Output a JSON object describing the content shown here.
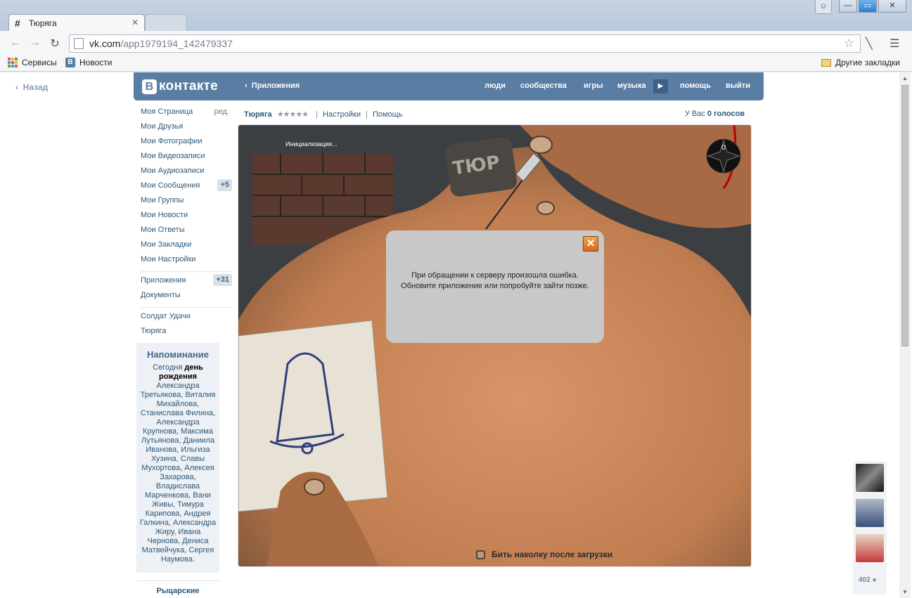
{
  "browser": {
    "tabs": [
      {
        "title": "Тюряга",
        "active": true
      },
      {
        "title": "",
        "active": false
      }
    ],
    "url_host": "vk.com",
    "url_path": "/app1979194_142479337",
    "bookmarks": [
      {
        "label": "Сервисы",
        "icon": "apps-grid-icon"
      },
      {
        "label": "Новости",
        "icon": "vk-icon"
      }
    ],
    "other_bookmarks": "Другие закладки"
  },
  "back_label": "Назад",
  "header": {
    "logo_letter": "В",
    "logo_text": "контакте",
    "apps_label": "Приложения",
    "nav": [
      "люди",
      "сообщества",
      "игры",
      "музыка",
      "помощь",
      "выйти"
    ],
    "accent": "#597da3"
  },
  "left_menu": {
    "items": [
      {
        "label": "Моя Страница",
        "extra": "ред."
      },
      {
        "label": "Мои Друзья"
      },
      {
        "label": "Мои Фотографии"
      },
      {
        "label": "Мои Видеозаписи"
      },
      {
        "label": "Мои Аудиозаписи"
      },
      {
        "label": "Мои Сообщения",
        "count": "+5"
      },
      {
        "label": "Мои Группы"
      },
      {
        "label": "Мои Новости"
      },
      {
        "label": "Мои Ответы"
      },
      {
        "label": "Мои Закладки"
      },
      {
        "label": "Мои Настройки"
      }
    ],
    "items2": [
      {
        "label": "Приложения",
        "count": "+31"
      },
      {
        "label": "Документы"
      }
    ],
    "items3": [
      {
        "label": "Солдат Удачи"
      },
      {
        "label": "Тюряга"
      }
    ]
  },
  "reminder": {
    "title": "Напоминание",
    "today": "Сегодня",
    "birthday": "день рождения",
    "names": "Александра Третьякова, Виталия Михайлова, Станислава Филина, Александра Крупнова, Максима Лутьянова, Даниила Иванова, Ильгиза Хузина, Славы Мухортова, Алексея Захарова, Владислава Марченкова, Вани Живы, Тимура Карипова, Андрея Галкина, Александра Жиру, Ивана Чернова, Дениса Матвейчука, Сергея Наумова."
  },
  "knights_label": "Рыцарские",
  "app": {
    "name": "Тюряга",
    "stars": "★★★★★",
    "settings": "Настройки",
    "help": "Помощь",
    "votes_prefix": "У Вас",
    "votes_value": "0 голосов",
    "init_text": "Инициализация...",
    "counter_value": "0",
    "tattoo_text": "ТЮР",
    "error_line1": "При обращении к серверу произошла ошибка.",
    "error_line2": "Обновите приложение или попробуйте зайти позже.",
    "autopin_label": "Бить наколку после загрузки"
  },
  "online": {
    "count": "402"
  }
}
